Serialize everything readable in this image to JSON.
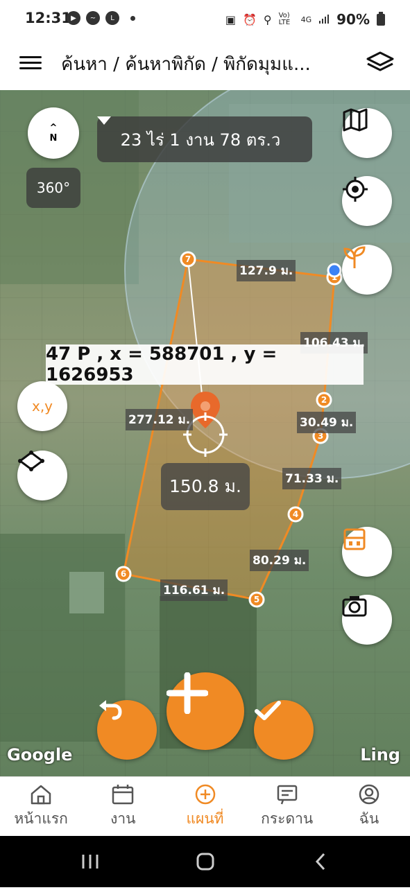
{
  "status": {
    "time": "12:31",
    "battery": "90%",
    "left_icons": [
      "youtube-icon",
      "messenger-icon",
      "line-icon"
    ],
    "right_icons": [
      "nfc-icon",
      "alarm-icon",
      "location-icon",
      "volte-icon",
      "4g-icon",
      "signal-icon",
      "battery-icon"
    ],
    "volte_label": "Vo) LTE",
    "net_label": "4G"
  },
  "appbar": {
    "title": "ค้นหา / ค้นหาพิกัด / พิกัดมุมแ...",
    "menu_icon": "hamburger-icon",
    "layers_icon": "layers-icon"
  },
  "map": {
    "compass_arrow": "^",
    "compass_label": "N",
    "rotation_label": "360°",
    "area_label": "23 ไร่ 1 งาน 78 ตร.ว",
    "coord_text": "47 P , x = 588701 , y = 1626953",
    "center_distance": "150.8 ม.",
    "google_label": "Google",
    "watermark": "Ling",
    "xy_button": "x,y",
    "vertices": [
      "1",
      "2",
      "3",
      "4",
      "5",
      "6",
      "7"
    ],
    "edges": [
      "127.9 ม.",
      "106.43 ม.",
      "30.49 ม.",
      "71.33 ม.",
      "80.29 ม.",
      "116.61 ม.",
      "277.12 ม."
    ],
    "accent_color": "#f08a24"
  },
  "nav": {
    "items": [
      {
        "label": "หน้าแรก",
        "icon": "home-icon"
      },
      {
        "label": "งาน",
        "icon": "calendar-icon"
      },
      {
        "label": "แผนที่",
        "icon": "map-plus-icon"
      },
      {
        "label": "กระดาน",
        "icon": "board-icon"
      },
      {
        "label": "ฉัน",
        "icon": "profile-icon"
      }
    ]
  }
}
